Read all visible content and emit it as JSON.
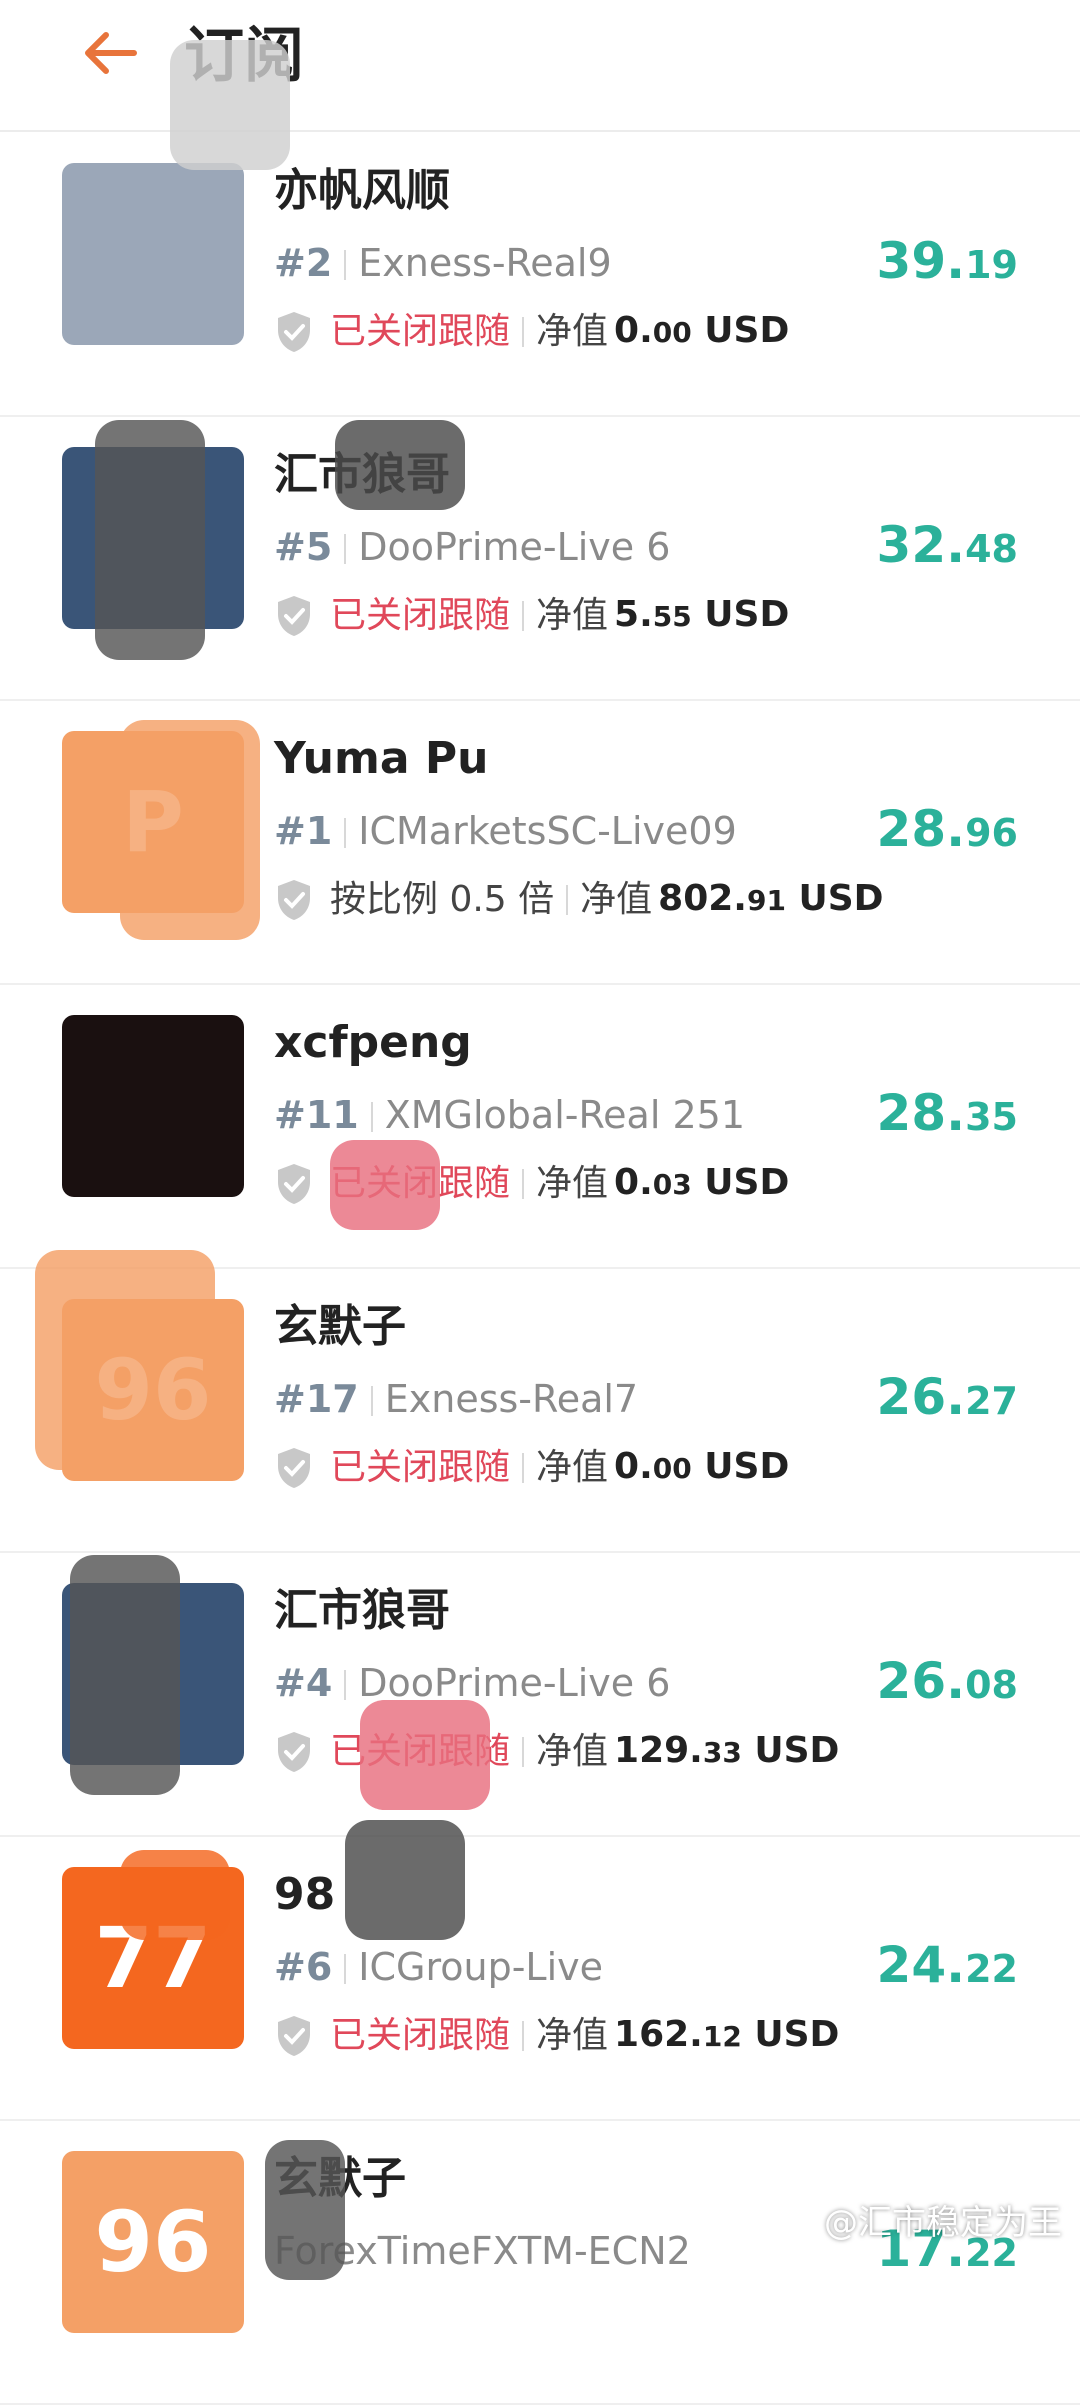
{
  "header": {
    "title": "订阅",
    "accent": "#e8743b"
  },
  "rows": [
    {
      "name": "亦帆风顺",
      "rank": "#2",
      "server": "Exness-Real9",
      "status": "已关闭跟随",
      "status_type": "closed",
      "nv_label": "净值",
      "nv_int": "0.",
      "nv_dec": "00",
      "nv_unit": "USD",
      "score_int": "39.",
      "score_dec": "19",
      "avatar_text": "",
      "avatar_color": "#9ba7b8"
    },
    {
      "name": "汇市狼哥",
      "rank": "#5",
      "server": "DooPrime-Live 6",
      "status": "已关闭跟随",
      "status_type": "closed",
      "nv_label": "净值",
      "nv_int": "5.",
      "nv_dec": "55",
      "nv_unit": "USD",
      "score_int": "32.",
      "score_dec": "48",
      "avatar_text": "",
      "avatar_color": "#3a5578"
    },
    {
      "name": "Yuma Pu",
      "rank": "#1",
      "server": "ICMarketsSC-Live09",
      "status": "按比例 0.5 倍",
      "status_type": "ratio",
      "nv_label": "净值",
      "nv_int": "802.",
      "nv_dec": "91",
      "nv_unit": "USD",
      "score_int": "28.",
      "score_dec": "96",
      "avatar_text": "P",
      "avatar_color": "#f4a066"
    },
    {
      "name": "xcfpeng",
      "rank": "#11",
      "server": "XMGlobal-Real 251",
      "status": "已关闭跟随",
      "status_type": "closed",
      "nv_label": "净值",
      "nv_int": "0.",
      "nv_dec": "03",
      "nv_unit": "USD",
      "score_int": "28.",
      "score_dec": "35",
      "avatar_text": "",
      "avatar_color": "#1a1010"
    },
    {
      "name": "玄默子",
      "rank": "#17",
      "server": "Exness-Real7",
      "status": "已关闭跟随",
      "status_type": "closed",
      "nv_label": "净值",
      "nv_int": "0.",
      "nv_dec": "00",
      "nv_unit": "USD",
      "score_int": "26.",
      "score_dec": "27",
      "avatar_text": "96",
      "avatar_color": "#f4a066"
    },
    {
      "name": "汇市狼哥",
      "rank": "#4",
      "server": "DooPrime-Live 6",
      "status": "已关闭跟随",
      "status_type": "closed",
      "nv_label": "净值",
      "nv_int": "129.",
      "nv_dec": "33",
      "nv_unit": "USD",
      "score_int": "26.",
      "score_dec": "08",
      "avatar_text": "",
      "avatar_color": "#3a5578"
    },
    {
      "name": "98",
      "rank": "#6",
      "server": "ICGroup-Live",
      "status": "已关闭跟随",
      "status_type": "closed",
      "nv_label": "净值",
      "nv_int": "162.",
      "nv_dec": "12",
      "nv_unit": "USD",
      "score_int": "24.",
      "score_dec": "22",
      "avatar_text": "77",
      "avatar_color": "#f4671f"
    },
    {
      "name": "玄默子",
      "rank": "",
      "server": "ForexTimeFXTM-ECN2",
      "status": "",
      "status_type": "closed",
      "nv_label": "",
      "nv_int": "",
      "nv_dec": "",
      "nv_unit": "",
      "score_int": "17.",
      "score_dec": "22",
      "avatar_text": "96",
      "avatar_color": "#f4a066"
    }
  ],
  "colors": {
    "score": "#2bb19a",
    "closed": "#e0485a"
  },
  "watermark": "@汇市稳定为王"
}
